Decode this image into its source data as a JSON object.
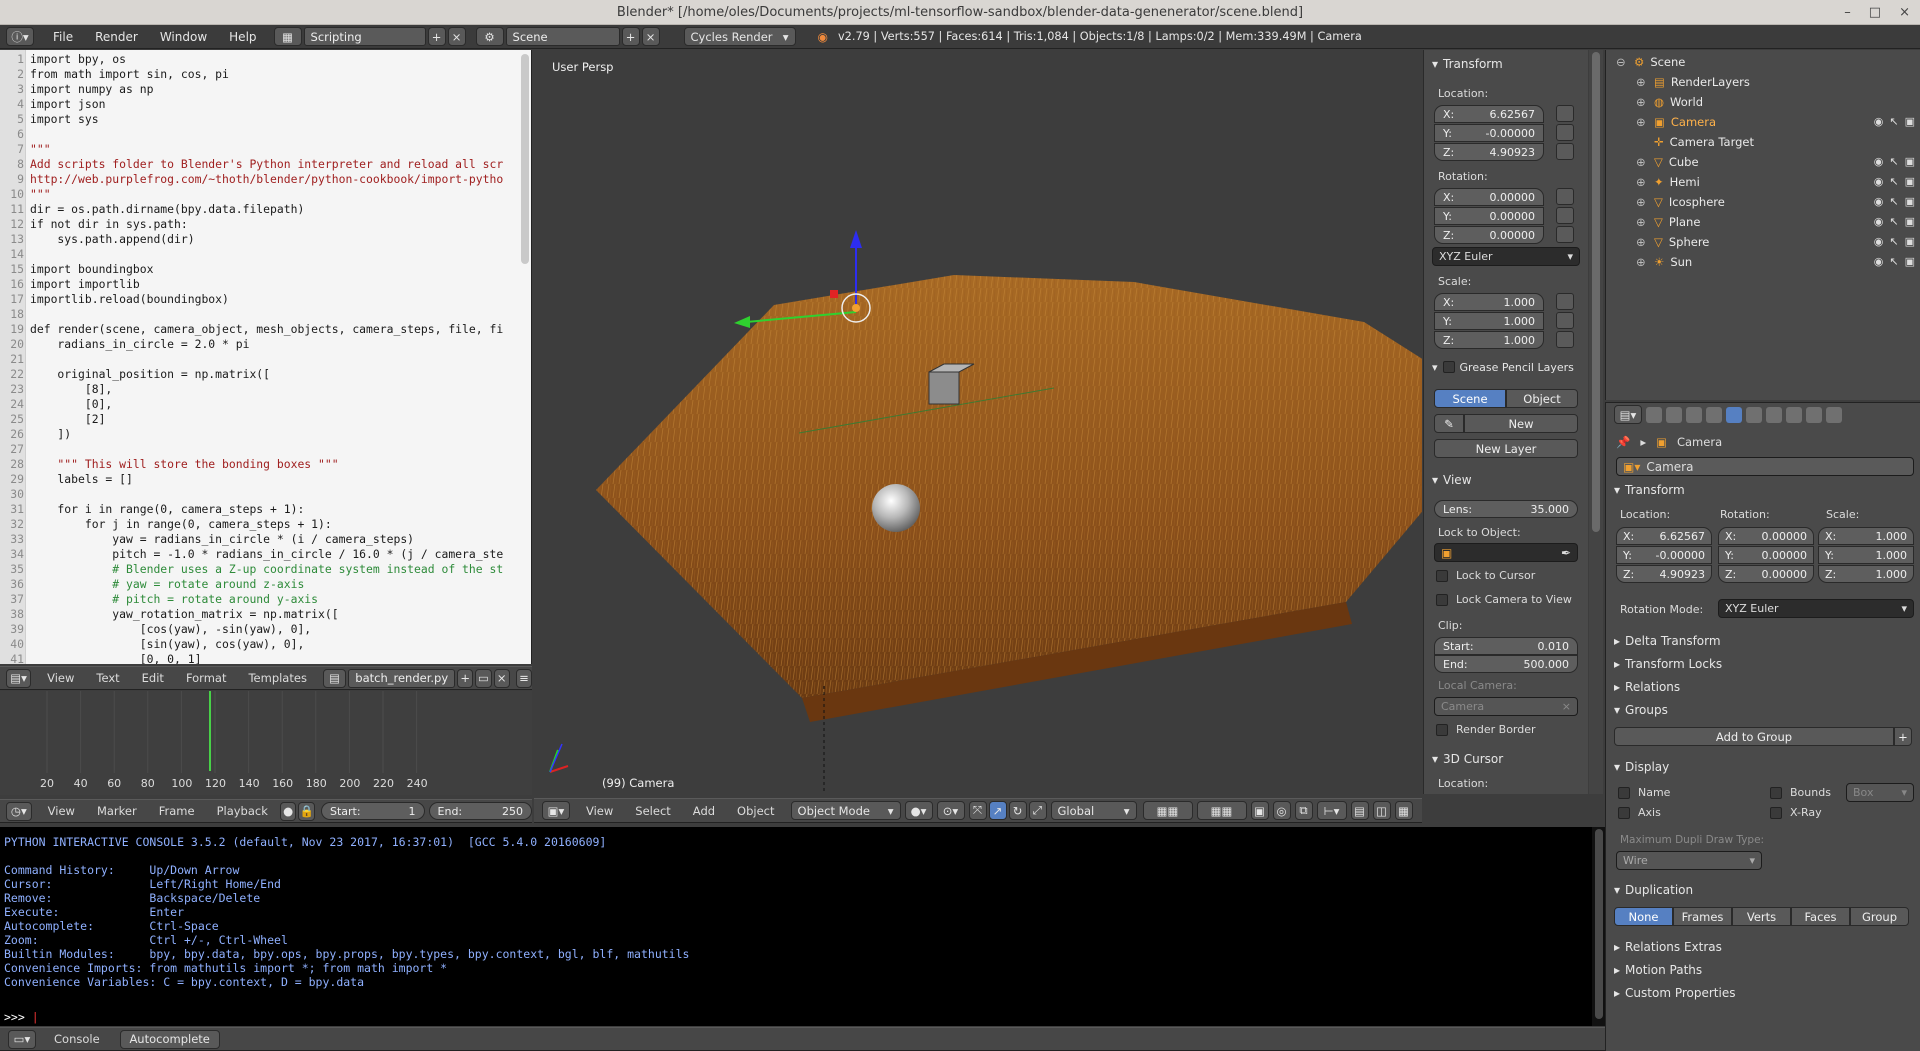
{
  "window": {
    "title": "Blender* [/home/oles/Documents/projects/ml-tensorflow-sandbox/blender-data-genenerator/scene.blend]",
    "min": "–",
    "max": "□",
    "close": "×"
  },
  "topbar": {
    "menus": [
      "File",
      "Render",
      "Window",
      "Help"
    ],
    "screen_layout": "Scripting",
    "scene": "Scene",
    "engine": "Cycles Render",
    "stats": "v2.79 | Verts:557 | Faces:614 | Tris:1,084 | Objects:1/8 | Lamps:0/2 | Mem:339.49M | Camera"
  },
  "editor": {
    "lines": [
      {
        "n": "1",
        "t": "import bpy, os"
      },
      {
        "n": "2",
        "t": "from math import sin, cos, pi"
      },
      {
        "n": "3",
        "t": "import numpy as np"
      },
      {
        "n": "4",
        "t": "import json"
      },
      {
        "n": "5",
        "t": "import sys"
      },
      {
        "n": "6",
        "t": ""
      },
      {
        "n": "7",
        "t": "\"\"\""
      },
      {
        "n": "8",
        "t": "Add scripts folder to Blender's Python interpreter and reload all scr"
      },
      {
        "n": "9",
        "t": "http://web.purplefrog.com/~thoth/blender/python-cookbook/import-pytho"
      },
      {
        "n": "10",
        "t": "\"\"\""
      },
      {
        "n": "11",
        "t": "dir = os.path.dirname(bpy.data.filepath)"
      },
      {
        "n": "12",
        "t": "if not dir in sys.path:"
      },
      {
        "n": "13",
        "t": "    sys.path.append(dir)"
      },
      {
        "n": "14",
        "t": ""
      },
      {
        "n": "15",
        "t": "import boundingbox"
      },
      {
        "n": "16",
        "t": "import importlib"
      },
      {
        "n": "17",
        "t": "importlib.reload(boundingbox)"
      },
      {
        "n": "18",
        "t": ""
      },
      {
        "n": "19",
        "t": "def render(scene, camera_object, mesh_objects, camera_steps, file, fi"
      },
      {
        "n": "20",
        "t": "    radians_in_circle = 2.0 * pi"
      },
      {
        "n": "21",
        "t": ""
      },
      {
        "n": "22",
        "t": "    original_position = np.matrix(["
      },
      {
        "n": "23",
        "t": "        [8],"
      },
      {
        "n": "24",
        "t": "        [0],"
      },
      {
        "n": "25",
        "t": "        [2]"
      },
      {
        "n": "26",
        "t": "    ])"
      },
      {
        "n": "27",
        "t": ""
      },
      {
        "n": "28",
        "t": "    \"\"\" This will store the bonding boxes \"\"\""
      },
      {
        "n": "29",
        "t": "    labels = []"
      },
      {
        "n": "30",
        "t": ""
      },
      {
        "n": "31",
        "t": "    for i in range(0, camera_steps + 1):"
      },
      {
        "n": "32",
        "t": "        for j in range(0, camera_steps + 1):"
      },
      {
        "n": "33",
        "t": "            yaw = radians_in_circle * (i / camera_steps)"
      },
      {
        "n": "34",
        "t": "            pitch = -1.0 * radians_in_circle / 16.0 * (j / camera_ste"
      },
      {
        "n": "35",
        "t": "            # Blender uses a Z-up coordinate system instead of the st"
      },
      {
        "n": "36",
        "t": "            # yaw = rotate around z-axis"
      },
      {
        "n": "37",
        "t": "            # pitch = rotate around y-axis"
      },
      {
        "n": "38",
        "t": "            yaw_rotation_matrix = np.matrix(["
      },
      {
        "n": "39",
        "t": "                [cos(yaw), -sin(yaw), 0],"
      },
      {
        "n": "40",
        "t": "                [sin(yaw), cos(yaw), 0],"
      },
      {
        "n": "41",
        "t": "                [0, 0, 1]"
      }
    ],
    "header_menus": [
      "View",
      "Text",
      "Edit",
      "Format",
      "Templates"
    ],
    "filename": "batch_render.py"
  },
  "timeline": {
    "ticks": [
      "20",
      "40",
      "60",
      "80",
      "100",
      "120",
      "140",
      "160",
      "180",
      "200",
      "220",
      "240"
    ],
    "menus": [
      "View",
      "Marker",
      "Frame",
      "Playback"
    ],
    "start_label": "Start:",
    "start": "1",
    "end_label": "End:",
    "end": "250"
  },
  "viewport": {
    "persp": "User Persp",
    "object_label": "(99) Camera",
    "menus": [
      "View",
      "Select",
      "Add",
      "Object"
    ],
    "mode": "Object Mode",
    "orientation": "Global"
  },
  "npanel": {
    "transform": "Transform",
    "location": "Location:",
    "loc": [
      {
        "a": "X:",
        "v": "6.62567"
      },
      {
        "a": "Y:",
        "v": "-0.00000"
      },
      {
        "a": "Z:",
        "v": "4.90923"
      }
    ],
    "rotation": "Rotation:",
    "rot": [
      {
        "a": "X:",
        "v": "0.00000"
      },
      {
        "a": "Y:",
        "v": "0.00000"
      },
      {
        "a": "Z:",
        "v": "0.00000"
      }
    ],
    "rot_mode": "XYZ Euler",
    "scale": "Scale:",
    "scl": [
      {
        "a": "X:",
        "v": "1.000"
      },
      {
        "a": "Y:",
        "v": "1.000"
      },
      {
        "a": "Z:",
        "v": "1.000"
      }
    ],
    "grease": "Grease Pencil Layers",
    "gp_scene": "Scene",
    "gp_object": "Object",
    "gp_new": "New",
    "gp_new_layer": "New Layer",
    "view": "View",
    "lens_label": "Lens:",
    "lens": "35.000",
    "lock_obj": "Lock to Object:",
    "lock_cursor": "Lock to Cursor",
    "lock_cam": "Lock Camera to View",
    "clip": "Clip:",
    "clip_start_label": "Start:",
    "clip_start": "0.010",
    "clip_end_label": "End:",
    "clip_end": "500.000",
    "local_cam": "Local Camera:",
    "local_cam_val": "Camera",
    "render_border": "Render Border",
    "cursor3d": "3D Cursor",
    "cursor_loc": "Location:"
  },
  "outliner": {
    "items": [
      {
        "name": "Scene",
        "depth": 0
      },
      {
        "name": "RenderLayers",
        "depth": 1
      },
      {
        "name": "World",
        "depth": 1
      },
      {
        "name": "Camera",
        "depth": 1,
        "active": true
      },
      {
        "name": "Camera Target",
        "depth": 1
      },
      {
        "name": "Cube",
        "depth": 1
      },
      {
        "name": "Hemi",
        "depth": 1
      },
      {
        "name": "Icosphere",
        "depth": 1
      },
      {
        "name": "Plane",
        "depth": 1
      },
      {
        "name": "Sphere",
        "depth": 1
      },
      {
        "name": "Sun",
        "depth": 1
      }
    ]
  },
  "props": {
    "breadcrumb": "Camera",
    "object_name": "Camera",
    "transform": "Transform",
    "location": "Location:",
    "rotation": "Rotation:",
    "scale": "Scale:",
    "loc": [
      {
        "a": "X:",
        "v": "6.62567"
      },
      {
        "a": "Y:",
        "v": "-0.00000"
      },
      {
        "a": "Z:",
        "v": "4.90923"
      }
    ],
    "rot": [
      {
        "a": "X:",
        "v": "0.00000"
      },
      {
        "a": "Y:",
        "v": "0.00000"
      },
      {
        "a": "Z:",
        "v": "0.00000"
      }
    ],
    "scl": [
      {
        "a": "X:",
        "v": "1.000"
      },
      {
        "a": "Y:",
        "v": "1.000"
      },
      {
        "a": "Z:",
        "v": "1.000"
      }
    ],
    "rot_mode_label": "Rotation Mode:",
    "rot_mode": "XYZ Euler",
    "delta": "Delta Transform",
    "locks": "Transform Locks",
    "relations": "Relations",
    "groups": "Groups",
    "add_group": "Add to Group",
    "display": "Display",
    "d_name": "Name",
    "d_bounds": "Bounds",
    "d_box": "Box",
    "d_axis": "Axis",
    "d_xray": "X-Ray",
    "dupli_label": "Maximum Dupli Draw Type:",
    "dupli_val": "Wire",
    "duplication": "Duplication",
    "dup_tabs": [
      "None",
      "Frames",
      "Verts",
      "Faces",
      "Group"
    ],
    "rel_extras": "Relations Extras",
    "motion": "Motion Paths",
    "custom": "Custom Properties"
  },
  "console": {
    "lines": [
      "PYTHON INTERACTIVE CONSOLE 3.5.2 (default, Nov 23 2017, 16:37:01)  [GCC 5.4.0 20160609]",
      "",
      "Command History:     Up/Down Arrow",
      "Cursor:              Left/Right Home/End",
      "Remove:              Backspace/Delete",
      "Execute:             Enter",
      "Autocomplete:        Ctrl-Space",
      "Zoom:                Ctrl +/-, Ctrl-Wheel",
      "Builtin Modules:     bpy, bpy.data, bpy.ops, bpy.props, bpy.types, bpy.context, bgl, blf, mathutils",
      "Convenience Imports: from mathutils import *; from math import *",
      "Convenience Variables: C = bpy.context, D = bpy.data"
    ],
    "prompt": ">>> ",
    "tab_console": "Console",
    "tab_autocomplete": "Autocomplete"
  }
}
